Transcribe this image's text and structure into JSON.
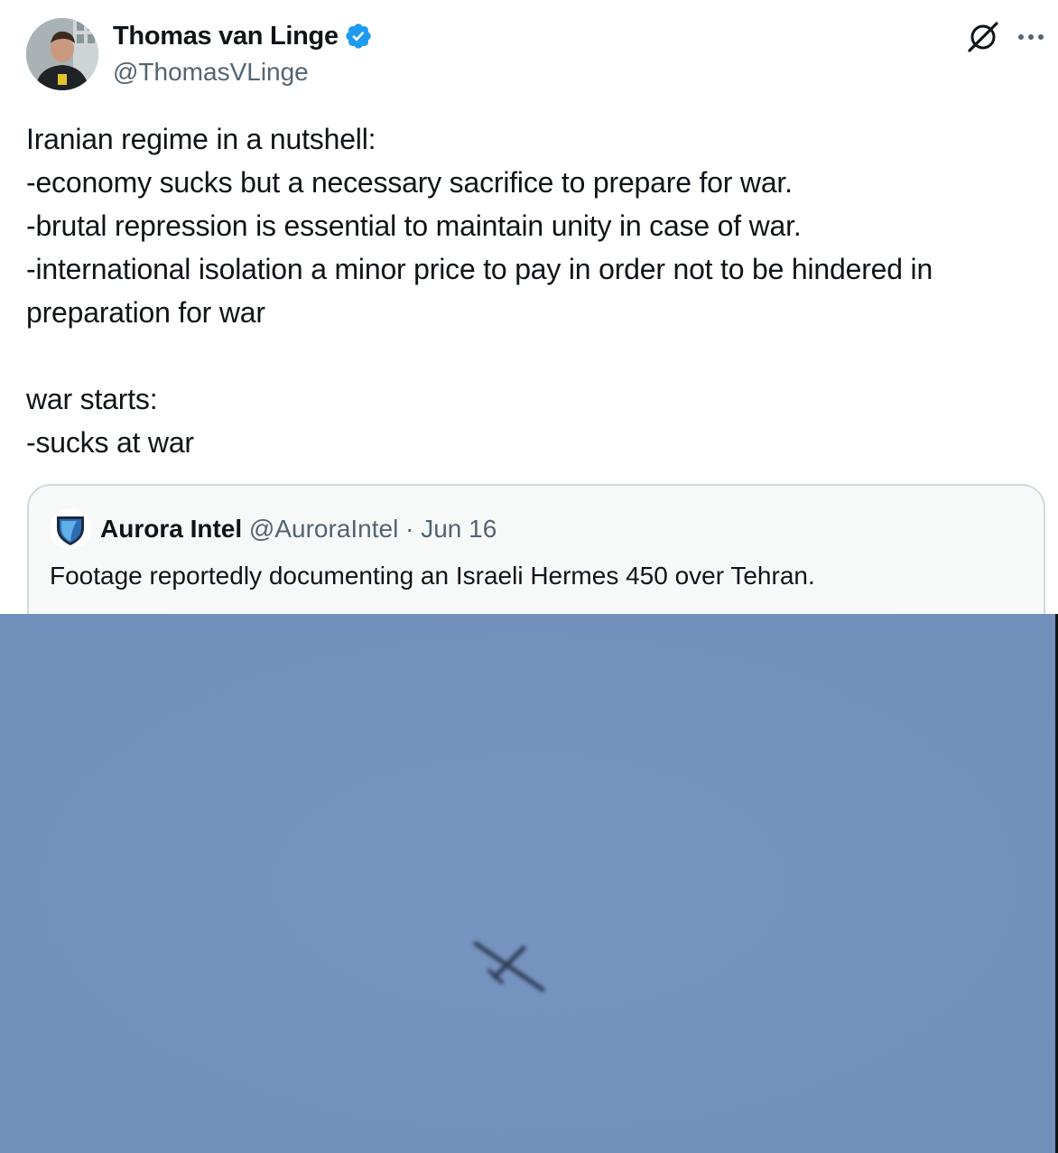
{
  "author": {
    "display_name": "Thomas van Linge",
    "handle": "@ThomasVLinge",
    "verified": true,
    "avatar_icon": "profile-photo"
  },
  "actions": {
    "grok_icon": "grok-icon",
    "more_icon": "more-horizontal-icon"
  },
  "tweet": {
    "lines": [
      "Iranian regime in a nutshell:",
      "-economy sucks but a necessary sacrifice to prepare for war.",
      "-brutal repression is essential to maintain unity in case of war.",
      "-international isolation a minor price to pay in order not to be hindered in",
      "preparation for war",
      "",
      "war starts:",
      "-sucks at war"
    ]
  },
  "quote": {
    "display_name": "Aurora Intel",
    "handle": "@AuroraIntel",
    "separator": "·",
    "date": "Jun 16",
    "text": "Footage reportedly documenting an Israeli Hermes 450 over Tehran.",
    "avatar_icon": "shield-logo",
    "media_description_icon": "drone-in-sky-photo"
  },
  "colors": {
    "verified_blue": "#1d9bf0",
    "secondary_text": "#536471",
    "primary_text": "#0f1419",
    "sky": "#7491bd"
  }
}
